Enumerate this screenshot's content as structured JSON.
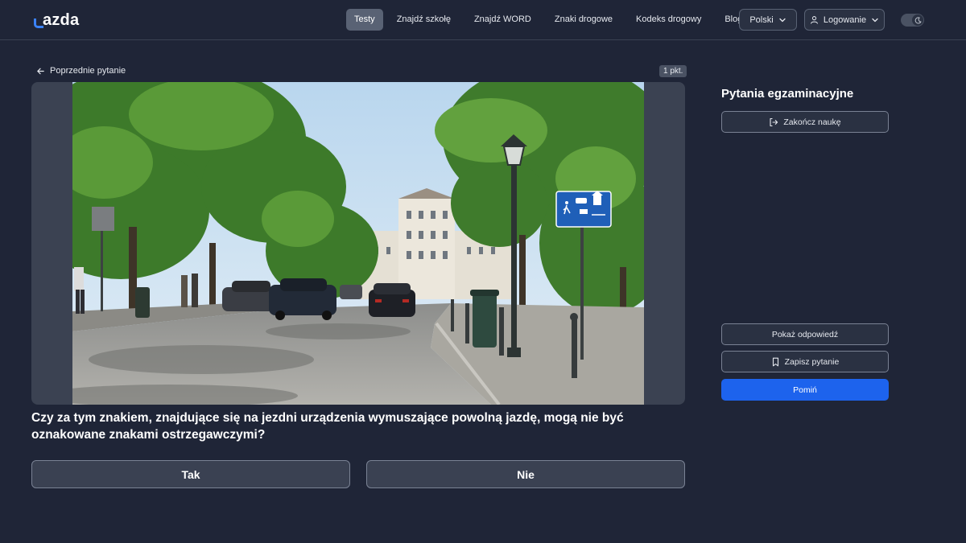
{
  "header": {
    "logo_text": "azda",
    "nav": [
      {
        "label": "Testy",
        "active": true
      },
      {
        "label": "Znajdź szkołę",
        "active": false
      },
      {
        "label": "Znajdź WORD",
        "active": false
      },
      {
        "label": "Znaki drogowe",
        "active": false
      },
      {
        "label": "Kodeks drogowy",
        "active": false
      },
      {
        "label": "Blog",
        "active": false
      }
    ],
    "language_label": "Polski",
    "login_label": "Logowanie",
    "theme_icon": "moon-icon"
  },
  "question": {
    "prev_label": "Poprzednie pytanie",
    "points_label": "1 pkt.",
    "text": "Czy za tym znakiem, znajdujące się na jezdni urządzenia wymuszające powolną jazdę, mogą nie być oznakowane znakami ostrzegawczymi?",
    "answers": [
      "Tak",
      "Nie"
    ]
  },
  "sidebar": {
    "title": "Pytania egzaminacyjne",
    "finish_label": "Zakończ naukę",
    "show_answer_label": "Pokaż odpowiedź",
    "save_label": "Zapisz pytanie",
    "skip_label": "Pomiń"
  },
  "colors": {
    "background": "#1f2537",
    "accent": "#1d63ed",
    "sign_blue": "#1f5fb8"
  }
}
